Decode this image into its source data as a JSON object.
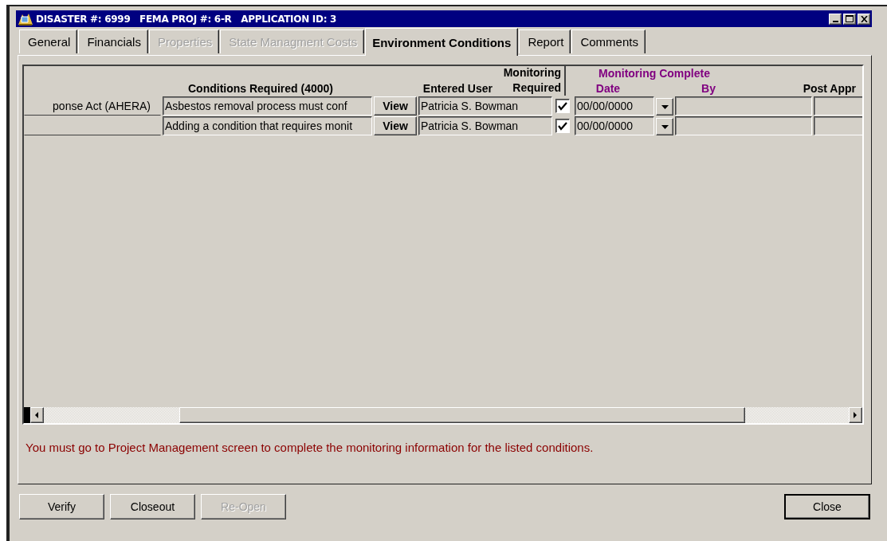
{
  "window": {
    "title": "DISASTER #: 6999   FEMA PROJ #: 6-R   APPLICATION ID: 3"
  },
  "tabs": [
    {
      "label": "General",
      "selected": false,
      "disabled": false
    },
    {
      "label": "Financials",
      "selected": false,
      "disabled": false
    },
    {
      "label": "Properties",
      "selected": false,
      "disabled": true
    },
    {
      "label": "State Managment Costs",
      "selected": false,
      "disabled": true
    },
    {
      "label": "Environment Conditions",
      "selected": true,
      "disabled": false
    },
    {
      "label": "Report",
      "selected": false,
      "disabled": false
    },
    {
      "label": "Comments",
      "selected": false,
      "disabled": false
    }
  ],
  "table": {
    "columns": [
      {
        "label": "Conditions Required (4000)",
        "kind": "plain"
      },
      {
        "label": "Entered User",
        "kind": "plain"
      },
      {
        "label": "Monitoring Required",
        "kind": "plain"
      },
      {
        "label": "Date",
        "kind": "monitoring"
      },
      {
        "label": "By",
        "kind": "monitoring"
      },
      {
        "label": "Post Appr",
        "kind": "plain"
      }
    ],
    "group_header": "Monitoring Complete",
    "rows": [
      {
        "column_1": "ponse Act (AHERA)",
        "condition": "Asbestos removal process must conf",
        "view": "View",
        "entered_user": "Patricia S. Bowman",
        "monitoring_required": true,
        "date": "00/00/0000"
      },
      {
        "condition": "Adding a condition that requires monit",
        "view": "View",
        "entered_user": "Patricia S. Bowman",
        "monitoring_required": true,
        "date": "00/00/0000"
      }
    ]
  },
  "message": "You must go to Project Management screen to complete the monitoring information for the listed conditions.",
  "buttons": [
    {
      "label": "Verify",
      "disabled": false
    },
    {
      "label": "Closeout",
      "disabled": false
    },
    {
      "label": "Re-Open",
      "disabled": true
    }
  ],
  "close_button": "Close"
}
